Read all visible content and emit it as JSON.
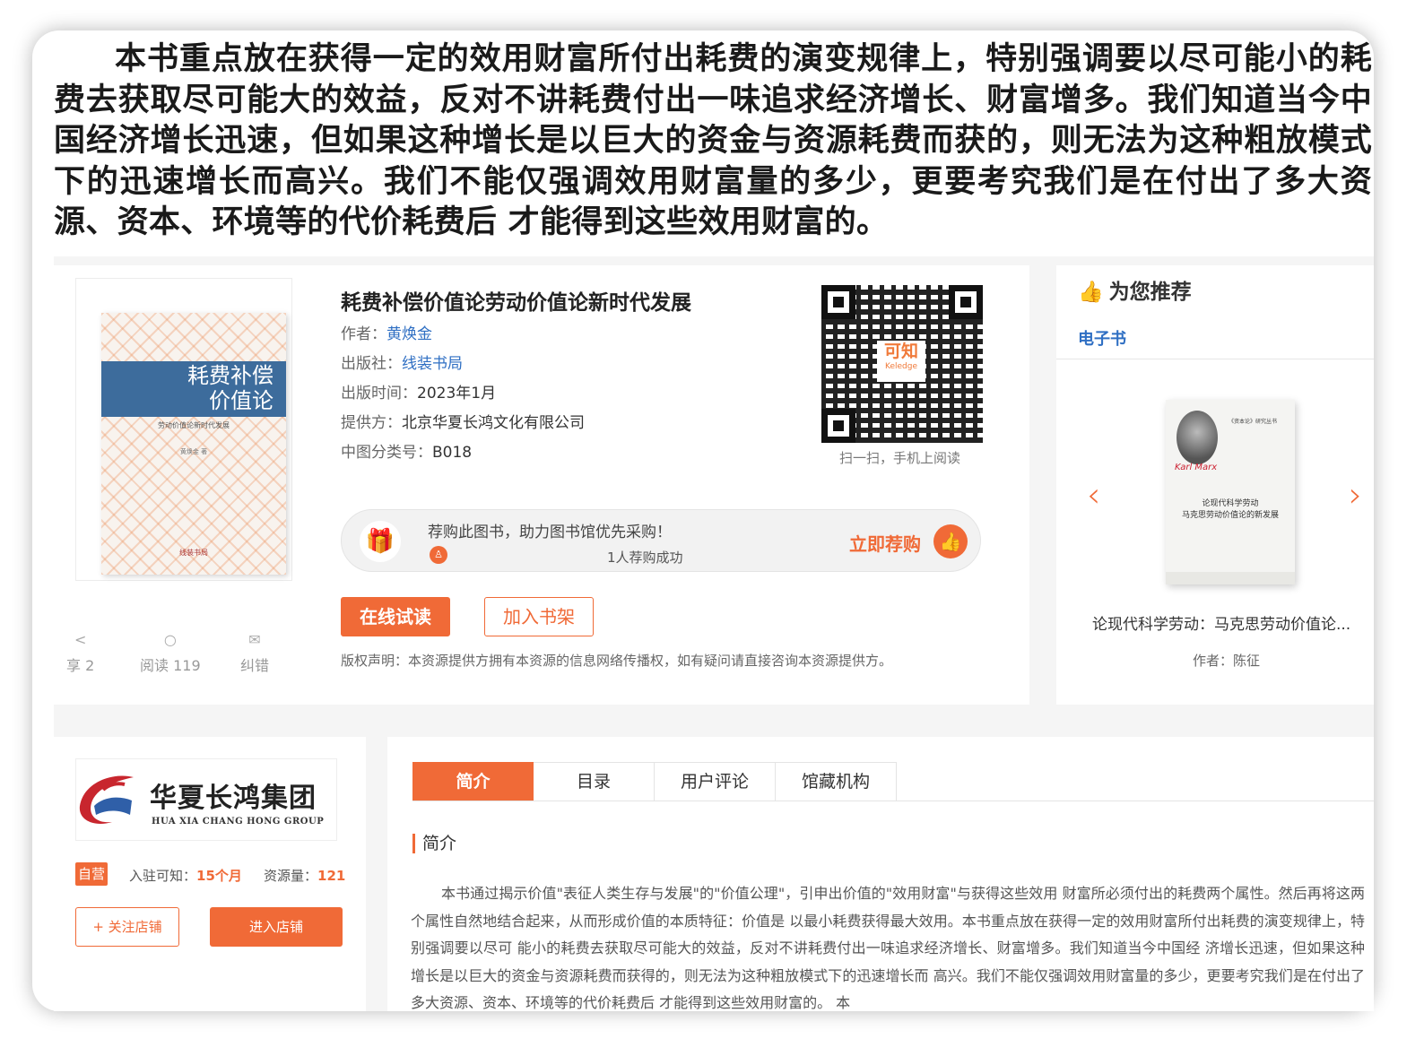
{
  "overlay_text": "本书重点放在获得一定的效用财富所付出耗费的演变规律上，特别强调要以尽可能小的耗费去获取尽可能大的效益，反对不讲耗费付出一味追求经济增长、财富增多。我们知道当今中国经济增长迅速，但如果这种增长是以巨大的资金与资源耗费而获的，则无法为这种粗放模式下的迅速增长而高兴。我们不能仅强调效用财富量的多少，更要考究我们是在付出了多大资源、资本、环境等的代价耗费后 才能得到这些效用财富的。",
  "book": {
    "cover_title": "耗费补偿价值论",
    "cover_subtitle": "劳动价值论新时代发展",
    "cover_author": "黄焕金 著",
    "cover_publisher": "线装书局",
    "title": "耗费补偿价值论劳动价值论新时代发展",
    "author_label": "作者：",
    "author": "黄焕金",
    "publisher_label": "出版社：",
    "publisher": "线装书局",
    "date_label": "出版时间：",
    "date": "2023年1月",
    "provider_label": "提供方：",
    "provider": "北京华夏长鸿文化有限公司",
    "class_label": "中图分类号：",
    "class_no": "B018"
  },
  "qr": {
    "logo_cn": "可知",
    "logo_en": "Keledge",
    "caption": "扫一扫，手机上阅读"
  },
  "recommend_bar": {
    "text": "荐购此图书，助力图书馆优先采购！",
    "count": "1人荐购成功",
    "action": "立即荐购"
  },
  "actions": {
    "read_online": "在线试读",
    "add_shelf": "加入书架"
  },
  "copyright": "版权声明：本资源提供方拥有本资源的信息网络传播权，如有疑问请直接咨询本资源提供方。",
  "stats": {
    "share": "享 2",
    "read": "阅读 119",
    "error": "纠错"
  },
  "recommend": {
    "title": "为您推荐",
    "tab": "电子书",
    "item_name": "论现代科学劳动：马克思劳动价值论...",
    "item_author": "作者：陈征",
    "item_cover_title": "论现代科学劳动\n马克思劳动价值论的新发展",
    "item_cover_series": "《资本论》研究丛书"
  },
  "shop": {
    "logo_cn": "华夏长鸿集团",
    "logo_en": "HUA XIA CHANG HONG GROUP",
    "self_badge": "自营",
    "joined_label": "入驻可知：",
    "joined_value": "15个月",
    "resources_label": "资源量：",
    "resources_value": "121",
    "follow": "+ 关注店铺",
    "enter": "进入店铺"
  },
  "tabs": [
    "简介",
    "目录",
    "用户评论",
    "馆藏机构"
  ],
  "intro": {
    "heading": "简介",
    "text": "本书通过揭示价值\"表征人类生存与发展\"的\"价值公理\"，引申出价值的\"效用财富\"与获得这些效用 财富所必须付出的耗费两个属性。然后再将这两个属性自然地结合起来，从而形成价值的本质特征：价值是 以最小耗费获得最大效用。本书重点放在获得一定的效用财富所付出耗费的演变规律上，特别强调要以尽可 能小的耗费去获取尽可能大的效益，反对不讲耗费付出一味追求经济增长、财富增多。我们知道当今中国经 济增长迅速，但如果这种增长是以巨大的资金与资源耗费而获得的，则无法为这种粗放模式下的迅速增长而 高兴。我们不能仅强调效用财富量的多少，更要考究我们是在付出了多大资源、资本、环境等的代价耗费后 才能得到这些效用财富的。 本"
  },
  "colors": {
    "accent": "#f06a37",
    "link": "#2f6fc3",
    "cover_band": "#3d6c9c"
  }
}
